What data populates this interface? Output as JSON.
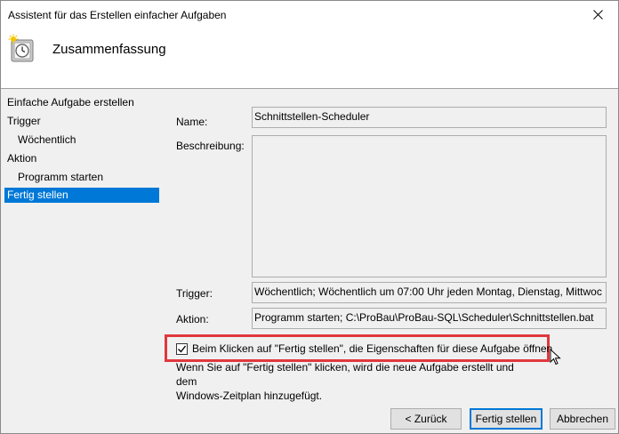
{
  "window": {
    "title": "Assistent für das Erstellen einfacher Aufgaben"
  },
  "header": {
    "title": "Zusammenfassung",
    "icon": "task-scheduler-clock-icon"
  },
  "sidebar": {
    "items": [
      {
        "label": "Einfache Aufgabe erstellen",
        "level": 0,
        "active": false
      },
      {
        "label": "Trigger",
        "level": 0,
        "active": false
      },
      {
        "label": "Wöchentlich",
        "level": 1,
        "active": false
      },
      {
        "label": "Aktion",
        "level": 0,
        "active": false
      },
      {
        "label": "Programm starten",
        "level": 1,
        "active": false
      },
      {
        "label": "Fertig stellen",
        "level": 0,
        "active": true
      }
    ]
  },
  "summary": {
    "name_label": "Name:",
    "name_value": "Schnittstellen-Scheduler",
    "description_label": "Beschreibung:",
    "description_value": "",
    "trigger_label": "Trigger:",
    "trigger_value": "Wöchentlich; Wöchentlich um 07:00 Uhr jeden Montag, Dienstag, Mittwoc",
    "action_label": "Aktion:",
    "action_value": "Programm starten; C:\\ProBau\\ProBau-SQL\\Scheduler\\Schnittstellen.bat"
  },
  "options": {
    "open_properties_label": "Beim Klicken auf \"Fertig stellen\", die Eigenschaften für diese Aufgabe öffnen",
    "open_properties_checked": true
  },
  "note": {
    "line1": "Wenn Sie auf \"Fertig stellen\" klicken, wird die neue Aufgabe erstellt und dem",
    "line2": "Windows-Zeitplan hinzugefügt."
  },
  "buttons": {
    "back_label": "< Zurück",
    "finish_label": "Fertig stellen",
    "cancel_label": "Abbrechen"
  },
  "colors": {
    "accent": "#0078d7",
    "highlight_border": "#e0383e"
  }
}
